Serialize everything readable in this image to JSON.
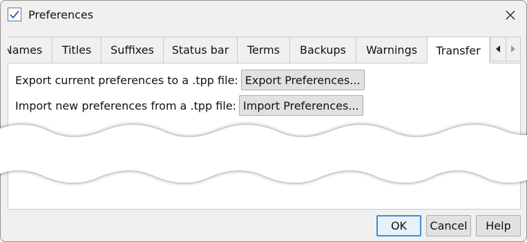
{
  "window": {
    "title": "Preferences"
  },
  "tabs": [
    {
      "label": "Names"
    },
    {
      "label": "Titles"
    },
    {
      "label": "Suffixes"
    },
    {
      "label": "Status bar"
    },
    {
      "label": "Terms"
    },
    {
      "label": "Backups"
    },
    {
      "label": "Warnings"
    },
    {
      "label": "Transfer",
      "active": true
    }
  ],
  "transfer": {
    "export_label": "Export current preferences to a .tpp file:",
    "export_button": "Export Preferences...",
    "import_label": "Import new preferences from a .tpp file:",
    "import_button": "Import Preferences..."
  },
  "footer": {
    "ok": "OK",
    "cancel": "Cancel",
    "help": "Help"
  },
  "colors": {
    "accent": "#3c8fd6",
    "app_icon_check": "#1f5fa8"
  },
  "icons": {
    "app": "checkbox-icon",
    "close": "close-icon",
    "scroll_left": "triangle-left-icon",
    "scroll_right": "triangle-right-icon"
  }
}
